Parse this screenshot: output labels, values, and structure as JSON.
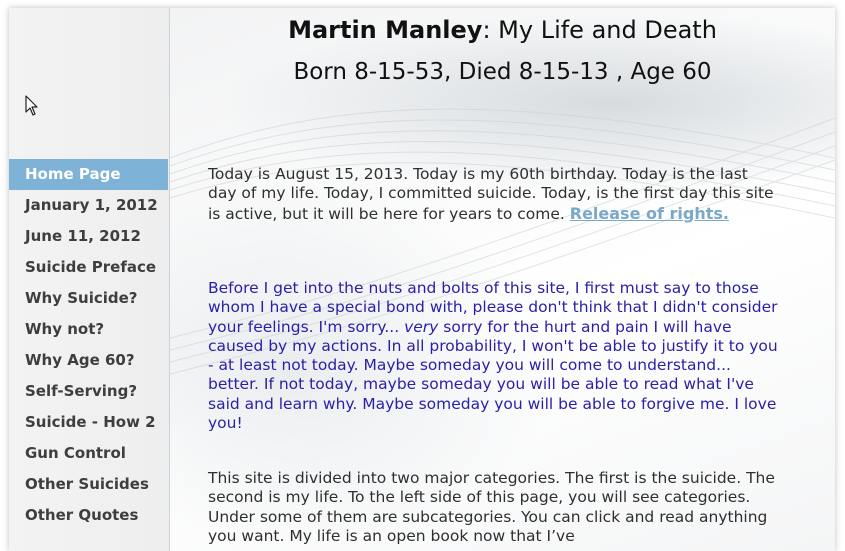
{
  "header": {
    "name": "Martin Manley",
    "title_rest": ": My Life and Death",
    "subtitle": "Born 8-15-53, Died 8-15-13 , Age 60"
  },
  "sidebar": {
    "items": [
      {
        "label": "Home Page",
        "active": true
      },
      {
        "label": "January 1, 2012"
      },
      {
        "label": "June 11, 2012"
      },
      {
        "label": "Suicide Preface"
      },
      {
        "label": "Why Suicide?"
      },
      {
        "label": "Why not?"
      },
      {
        "label": "Why Age 60?"
      },
      {
        "label": "Self-Serving?"
      },
      {
        "label": "Suicide - How 2"
      },
      {
        "label": "Gun Control"
      },
      {
        "label": "Other Suicides"
      },
      {
        "label": "Other Quotes"
      }
    ]
  },
  "main": {
    "p1_text": "Today is August 15, 2013. Today is my 60th birthday. Today is the last day of my life. Today, I committed suicide. Today, is the first day this site is active, but it will be here for years to come. ",
    "p1_link": "Release of rights.",
    "p2_before": "Before I get into the nuts and bolts of this site, I first must say to those whom I have a special bond with, please don't think that I didn't consider your feelings. I'm sorry... ",
    "p2_em": "very",
    "p2_after": " sorry for the hurt and pain I will have caused by my actions. In all probability, I won't be able to justify it to you - at least not today. Maybe someday you will come to understand... better. If not today, maybe someday you will be able to read what I've said and learn why. Maybe someday you will be able to forgive me. I love you!",
    "p3_text": "This site is divided into two major categories. The first is the suicide. The second is my life. To the left side of this page, you will see categories. Under some of them are subcategories. You can click and read anything you want. My life is an open book now that I’ve"
  },
  "colors": {
    "nav_active_bg": "#7eb2d6",
    "nav_text": "#3e3e3e",
    "appeal_text": "#2a1fa8",
    "link": "#7aa8c9"
  },
  "icons": {
    "cursor": "mouse-pointer-icon"
  }
}
